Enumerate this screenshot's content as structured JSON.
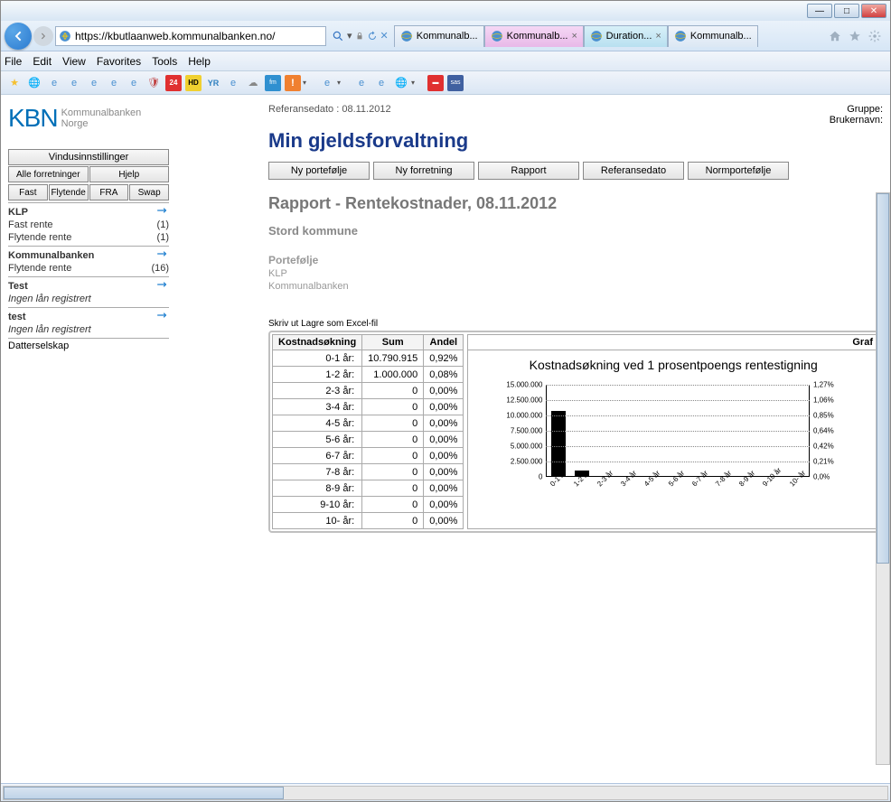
{
  "browser": {
    "url": "https://kbutlaanweb.kommunalbanken.no/",
    "tabs": [
      {
        "label": "Kommunalb...",
        "active": false
      },
      {
        "label": "Kommunalb...",
        "active": true
      },
      {
        "label": "Duration...",
        "active2": true
      },
      {
        "label": "Kommunalb...",
        "active": false
      }
    ],
    "menu": [
      "File",
      "Edit",
      "View",
      "Favorites",
      "Tools",
      "Help"
    ]
  },
  "sidebar": {
    "logo_main": "KBN",
    "logo_sub1": "Kommunalbanken",
    "logo_sub2": "Norge",
    "vindu": "Vindusinnstillinger",
    "alle": "Alle forretninger",
    "hjelp": "Hjelp",
    "tabs": [
      "Fast",
      "Flytende",
      "FRA",
      "Swap"
    ],
    "sections": [
      {
        "title": "KLP",
        "rows": [
          {
            "label": "Fast rente",
            "count": "(1)"
          },
          {
            "label": "Flytende rente",
            "count": "(1)"
          }
        ]
      },
      {
        "title": "Kommunalbanken",
        "rows": [
          {
            "label": "Flytende rente",
            "count": "(16)"
          }
        ]
      },
      {
        "title": "Test",
        "rows": [
          {
            "label": "Ingen lån registrert",
            "count": "",
            "italic": true
          }
        ]
      },
      {
        "title": "test",
        "rows": [
          {
            "label": "Ingen lån registrert",
            "count": "",
            "italic": true
          }
        ]
      }
    ],
    "datter": "Datterselskap"
  },
  "main": {
    "ref_date": "Referansedato : 08.11.2012",
    "gruppe": "Gruppe:",
    "bruker": "Brukernavn:",
    "title": "Min gjeldsforvaltning",
    "tabs": [
      "Ny portefølje",
      "Ny forretning",
      "Rapport",
      "Referansedato",
      "Normportefølje"
    ],
    "report_title": "Rapport - Rentekostnader, 08.11.2012",
    "sub_title": "Stord kommune",
    "pf_label": "Portefølje",
    "pf_items": [
      "KLP",
      "Kommunalbanken"
    ],
    "print_links": {
      "skriv": "Skriv ut",
      "lagre": "Lagre som Excel-fil"
    },
    "table": {
      "headers": [
        "Kostnadsøkning",
        "Sum",
        "Andel"
      ],
      "graf_header": "Graf",
      "rows": [
        {
          "label": "0-1 år:",
          "sum": "10.790.915",
          "andel": "0,92%"
        },
        {
          "label": "1-2 år:",
          "sum": "1.000.000",
          "andel": "0,08%"
        },
        {
          "label": "2-3 år:",
          "sum": "0",
          "andel": "0,00%"
        },
        {
          "label": "3-4 år:",
          "sum": "0",
          "andel": "0,00%"
        },
        {
          "label": "4-5 år:",
          "sum": "0",
          "andel": "0,00%"
        },
        {
          "label": "5-6 år:",
          "sum": "0",
          "andel": "0,00%"
        },
        {
          "label": "6-7 år:",
          "sum": "0",
          "andel": "0,00%"
        },
        {
          "label": "7-8 år:",
          "sum": "0",
          "andel": "0,00%"
        },
        {
          "label": "8-9 år:",
          "sum": "0",
          "andel": "0,00%"
        },
        {
          "label": "9-10 år:",
          "sum": "0",
          "andel": "0,00%"
        },
        {
          "label": "10- år:",
          "sum": "0",
          "andel": "0,00%"
        }
      ]
    }
  },
  "chart_data": {
    "type": "bar",
    "title": "Kostnadsøkning ved 1 prosentpoengs rentestigning",
    "categories": [
      "0-1 år",
      "1-2 år",
      "2-3 år",
      "3-4 år",
      "4-5 år",
      "5-6 år",
      "6-7 år",
      "7-8 år",
      "8-9 år",
      "9-10 år",
      "10- år"
    ],
    "values": [
      10790915,
      1000000,
      0,
      0,
      0,
      0,
      0,
      0,
      0,
      0,
      0
    ],
    "y_ticks": [
      "15.000.000",
      "12.500.000",
      "10.000.000",
      "7.500.000",
      "5.000.000",
      "2.500.000",
      "0"
    ],
    "y_ticks_right": [
      "1,27%",
      "1,06%",
      "0,85%",
      "0,64%",
      "0,42%",
      "0,21%",
      "0,0%"
    ],
    "ylim": [
      0,
      15000000
    ]
  }
}
